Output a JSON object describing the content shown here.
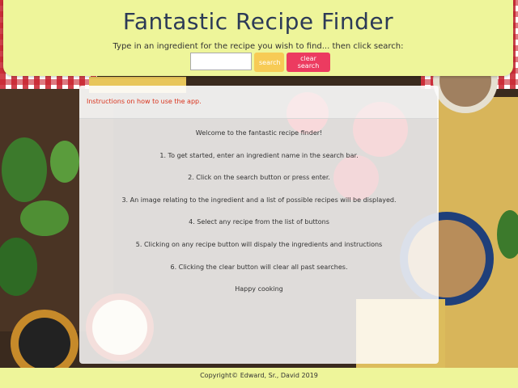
{
  "header": {
    "title": "Fantastic Recipe Finder",
    "subtitle": "Type in an ingredient for the recipe you wish to find... then click search:",
    "search_input_value": "",
    "search_label": "search",
    "clear_label": "clear search"
  },
  "instructions": {
    "header": "Instructions on how to use the app.",
    "lines": [
      "Welcome to the fantastic recipe finder!",
      "1. To get started, enter an ingredient name in the search bar.",
      "2. Click on the search button or press enter.",
      "3. An image relating to the ingredient and a list of possible recipes will be displayed.",
      "4. Select any recipe from the list of buttons",
      "5. Clicking on any recipe button will dispaly the ingredients and instructions",
      "6. Clicking the clear button will clear all past searches.",
      "Happy cooking"
    ]
  },
  "footer": {
    "text": "Copyright© Edward, Sr., David 2019"
  },
  "colors": {
    "header_bg": "#eef59a",
    "title": "#2c3a57",
    "search_button": "#f7cb55",
    "clear_button": "#ec3b60",
    "instructions_header_text": "#d9331d"
  }
}
